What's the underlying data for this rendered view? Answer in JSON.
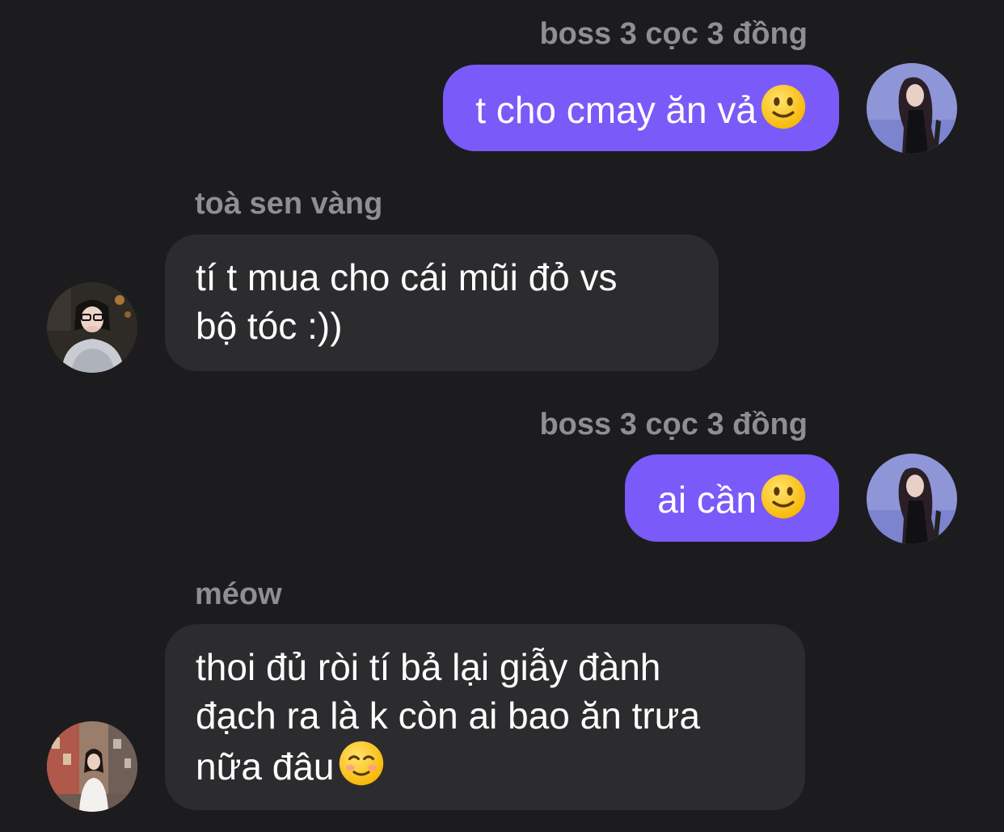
{
  "messages": [
    {
      "sender": "boss 3 cọc 3 đồng",
      "direction": "outgoing",
      "lines": [
        "t cho cmay ăn vả"
      ],
      "emoji": "slightly-smiling-face",
      "avatar": "avatar-boss"
    },
    {
      "sender": "toà sen vàng",
      "direction": "incoming",
      "lines": [
        "tí t mua cho cái mũi đỏ vs",
        "bộ tóc :))"
      ],
      "avatar": "avatar-toa-sen-vang"
    },
    {
      "sender": "boss 3 cọc 3 đồng",
      "direction": "outgoing",
      "lines": [
        "ai cần"
      ],
      "emoji": "slightly-smiling-face",
      "avatar": "avatar-boss"
    },
    {
      "sender": "méow",
      "direction": "incoming",
      "lines": [
        "thoi đủ ròi tí bả lại giẫy đành",
        "đạch ra là k còn ai bao ăn trưa",
        "nữa đâu"
      ],
      "emoji": "smiling-face",
      "avatar": "avatar-meow"
    }
  ],
  "colors": {
    "background": "#1c1c1e",
    "outgoing_bubble": "#7a5af8",
    "incoming_bubble": "#2c2c2e",
    "sender_name": "#8e8e93",
    "text": "#ffffff"
  }
}
